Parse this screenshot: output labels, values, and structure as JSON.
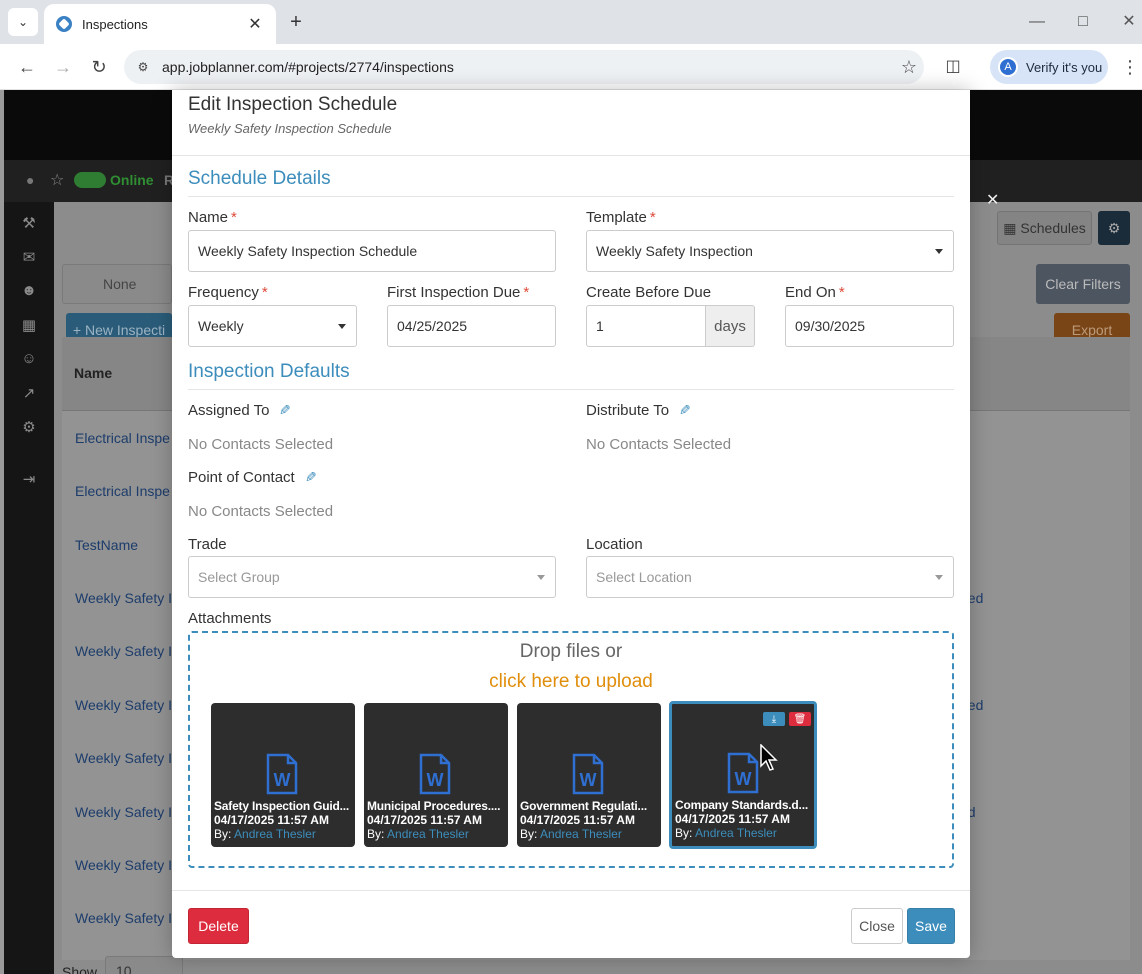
{
  "browser": {
    "tab_title": "Inspections",
    "url": "app.jobplanner.com/#projects/2774/inspections",
    "profile_initial": "A",
    "profile_label": "Verify it's you"
  },
  "background": {
    "status_label": "Online",
    "status_letter": "R",
    "filter_placeholder": "None",
    "new_button": "+ New Inspecti",
    "schedules_button": "Schedules",
    "clear_filters_button": "Clear Filters",
    "export_button": "Export",
    "name_column": "Name",
    "show_label": "Show",
    "show_value": "10",
    "rows": [
      {
        "name": "Electrical Inspe",
        "right": ""
      },
      {
        "name": "Electrical Inspe",
        "right": ""
      },
      {
        "name": "TestName",
        "right": ""
      },
      {
        "name": "Weekly Safety I",
        "right": "tted"
      },
      {
        "name": "Weekly Safety I",
        "right": "d"
      },
      {
        "name": "Weekly Safety I",
        "right": "tted"
      },
      {
        "name": "Weekly Safety I",
        "right": ""
      },
      {
        "name": "Weekly Safety I",
        "right": "ed"
      },
      {
        "name": "Weekly Safety I",
        "right": ""
      },
      {
        "name": "Weekly Safety I",
        "right": ""
      }
    ]
  },
  "modal": {
    "title": "Edit Inspection Schedule",
    "subtitle": "Weekly Safety Inspection Schedule",
    "schedule_section": "Schedule Details",
    "name_label": "Name",
    "name_value": "Weekly Safety Inspection Schedule",
    "template_label": "Template",
    "template_value": "Weekly Safety Inspection",
    "frequency_label": "Frequency",
    "frequency_value": "Weekly",
    "first_due_label": "First Inspection Due",
    "first_due_value": "04/25/2025",
    "create_before_label": "Create Before Due",
    "create_before_value": "1",
    "create_before_unit": "days",
    "end_on_label": "End On",
    "end_on_value": "09/30/2025",
    "defaults_section": "Inspection Defaults",
    "assigned_label": "Assigned To",
    "assigned_value": "No Contacts Selected",
    "distribute_label": "Distribute To",
    "distribute_value": "No Contacts Selected",
    "poc_label": "Point of Contact",
    "poc_value": "No Contacts Selected",
    "trade_label": "Trade",
    "trade_placeholder": "Select Group",
    "location_label": "Location",
    "location_placeholder": "Select Location",
    "attachments_label": "Attachments",
    "drop_text": "Drop files or",
    "drop_link": "click here to upload",
    "by_prefix": "By:",
    "files": [
      {
        "name": "Safety Inspection Guid...",
        "date": "04/17/2025 11:57 AM",
        "author": "Andrea Thesler"
      },
      {
        "name": "Municipal Procedures....",
        "date": "04/17/2025 11:57 AM",
        "author": "Andrea Thesler"
      },
      {
        "name": "Government Regulati...",
        "date": "04/17/2025 11:57 AM",
        "author": "Andrea Thesler"
      },
      {
        "name": "Company Standards.d...",
        "date": "04/17/2025 11:57 AM",
        "author": "Andrea Thesler"
      }
    ],
    "delete_button": "Delete",
    "close_button": "Close",
    "save_button": "Save",
    "required_mark": "*"
  },
  "colors": {
    "accent": "#3c8dbc",
    "danger": "#dd2c3e",
    "upload_link": "#e08e0b"
  }
}
